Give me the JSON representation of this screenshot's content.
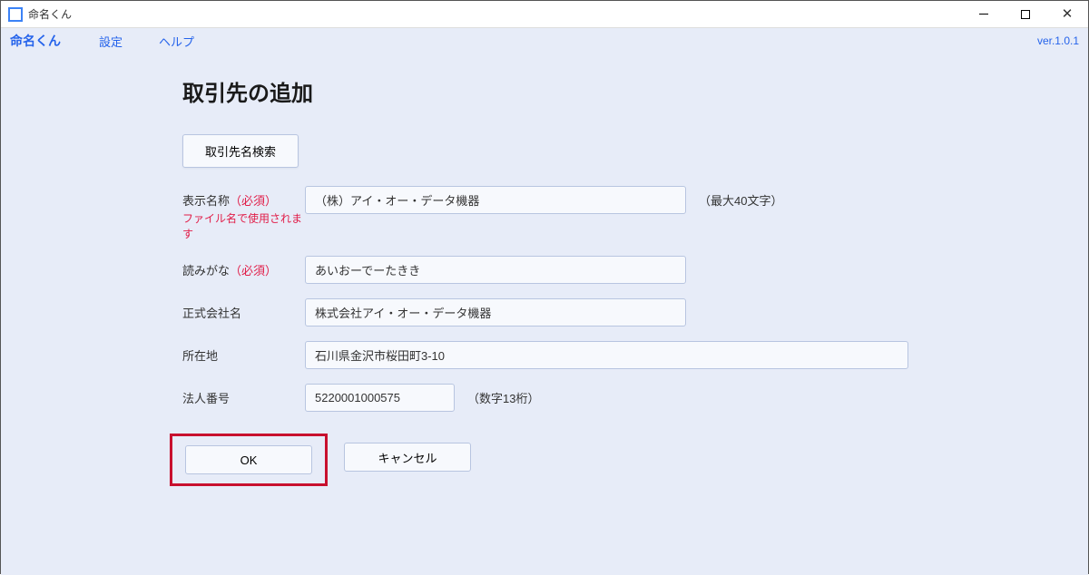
{
  "window": {
    "title": "命名くん"
  },
  "menubar": {
    "logo": "命名くん",
    "settings": "設定",
    "help": "ヘルプ",
    "version": "ver.1.0.1"
  },
  "page": {
    "title": "取引先の追加",
    "search_button": "取引先名検索",
    "fields": {
      "display_name": {
        "label": "表示名称",
        "required": "（必須）",
        "subnote": "ファイル名で使用されます",
        "value": "（株）アイ・オー・データ機器",
        "hint": "（最大40文字）"
      },
      "reading": {
        "label": "読みがな",
        "required": "（必須）",
        "value": "あいおーでーたきき"
      },
      "official_name": {
        "label": "正式会社名",
        "value": "株式会社アイ・オー・データ機器"
      },
      "address": {
        "label": "所在地",
        "value": "石川県金沢市桜田町3-10"
      },
      "corp_number": {
        "label": "法人番号",
        "value": "5220001000575",
        "hint": "（数字13桁）"
      }
    },
    "buttons": {
      "ok": "OK",
      "cancel": "キャンセル"
    }
  }
}
